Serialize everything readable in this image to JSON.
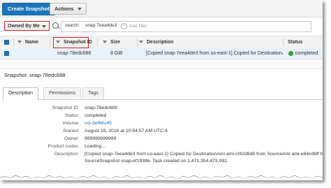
{
  "toolbar": {
    "create_label": "Create Snapshot",
    "actions_label": "Actions"
  },
  "filter": {
    "owned_label": "Owned By Me",
    "token_key": "search",
    "token_sep": ":",
    "token_value": "snap-7eea4de3",
    "remove_token_symbol": "×",
    "placeholder": "Add filter"
  },
  "table": {
    "headers": {
      "name": "Name",
      "snapshot_id": "Snapshot ID",
      "size": "Size",
      "description": "Description",
      "status": "Status"
    },
    "rows": [
      {
        "name": "",
        "snapshot_id": "snap-78edc688",
        "size": "8 GiB",
        "description": "[Copied snap-7eea4de3 from us-east-1] Copied for DestinationAmi ...",
        "status": "completed"
      }
    ]
  },
  "details": {
    "title": "Snapshot: snap-78edc688",
    "tabs": [
      "Description",
      "Permissions",
      "Tags"
    ],
    "fields": [
      {
        "label": "Snapshot ID",
        "value": "snap-78edc688"
      },
      {
        "label": "Status",
        "value": "completed"
      },
      {
        "label": "Volume",
        "value": "vol-3ef66c45"
      },
      {
        "label": "Started",
        "value": "August 16, 2016 at 10:54:57 AM UTC-4"
      },
      {
        "label": "Owner",
        "value": "999999999999"
      },
      {
        "label": "Product codes",
        "value": "Loading..."
      },
      {
        "label": "Description",
        "value": "[Copied snap-7eea4de3 from us-east-1] Copied for DestinationAmi ami-cf42d8d8 from SourceAmi ami-e84cd6ff for"
      },
      {
        "label": "",
        "value": "SourceSnapshot snap-ef19396. Task created on 1,471,354,473,092."
      }
    ]
  },
  "colors": {
    "primary": "#1b75bb",
    "highlight": "#d6201f",
    "selected_row": "#e8f0fa",
    "status_ok": "#35a135",
    "link": "#1a6fb5"
  }
}
